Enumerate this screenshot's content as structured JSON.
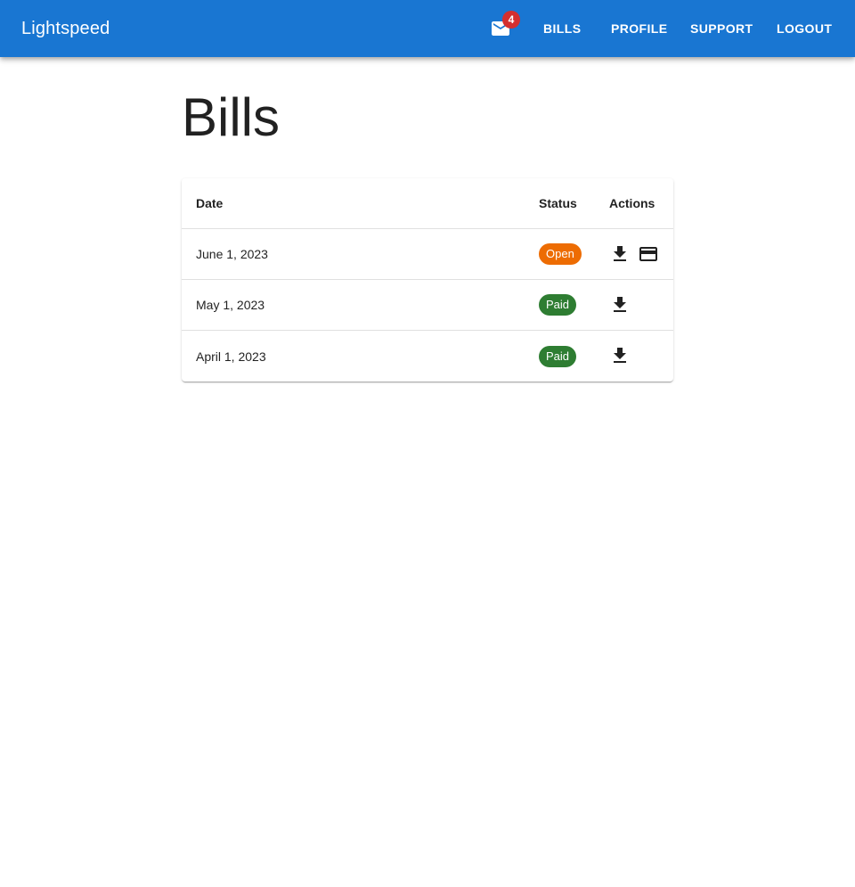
{
  "app": {
    "brand": "Lightspeed",
    "primary_color": "#1976d2",
    "mail": {
      "icon": "mail-icon",
      "badge_count": "4",
      "badge_color": "#d32f2f"
    },
    "nav": [
      {
        "label": "BILLS"
      },
      {
        "label": "PROFILE"
      },
      {
        "label": "SUPPORT"
      },
      {
        "label": "LOGOUT"
      }
    ]
  },
  "page": {
    "title": "Bills"
  },
  "table": {
    "headers": {
      "date": "Date",
      "status": "Status",
      "actions": "Actions"
    },
    "rows": [
      {
        "date": "June 1, 2023",
        "status": "Open",
        "status_color": "#ed6c02",
        "actions": [
          "download-icon",
          "credit-card-icon"
        ]
      },
      {
        "date": "May 1, 2023",
        "status": "Paid",
        "status_color": "#2e7d32",
        "actions": [
          "download-icon"
        ]
      },
      {
        "date": "April 1, 2023",
        "status": "Paid",
        "status_color": "#2e7d32",
        "actions": [
          "download-icon"
        ]
      }
    ]
  }
}
